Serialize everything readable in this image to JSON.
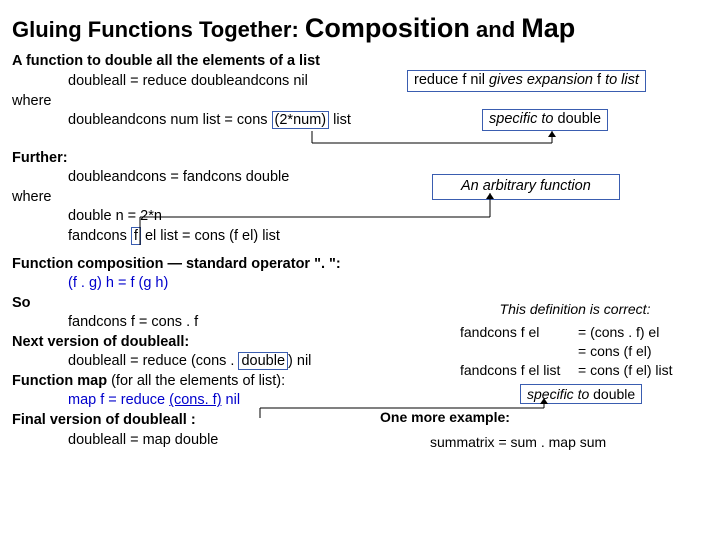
{
  "title": {
    "t1": "Gluing Functions Together:",
    "t2": "Composition",
    "t3": "and",
    "t4": "Map"
  },
  "s1": {
    "heading": "A function to double all the elements of a list",
    "line1": "doubleall = reduce doubleandcons nil",
    "note1_a": "reduce f nil ",
    "note1_b": "gives expansion",
    "note1_c": " f ",
    "note1_d": "to list",
    "where": "where",
    "line2a": "doubleandcons num list = cons ",
    "line2b": "(2*num)",
    "line2c": " list",
    "note2_a": "specific to ",
    "note2_b": "double"
  },
  "s2": {
    "heading": "Further:",
    "line1": "doubleandcons = fandcons double",
    "where": "where",
    "line2": "double n = 2*n",
    "line3a": "fandcons ",
    "line3b": "f",
    "line3c": " el list = cons (f el) list",
    "note": "An arbitrary function"
  },
  "s3": {
    "heading": "Function composition — standard operator \". \":",
    "def": "(f . g) h = f (g h)",
    "so": "So",
    "line1": "fandcons f = cons . f",
    "h2": "Next version of doubleall:",
    "line2a": "doubleall = reduce (cons . ",
    "line2b": "double",
    "line2c": ") nil",
    "h3": "Function map ",
    "h3b": "(for all the elements of list):",
    "line3a": "map f = reduce ",
    "line3b": "(cons. f)",
    "line3c": " nil",
    "h4": "Final version of doubleall :",
    "line4": "doubleall = map double"
  },
  "right": {
    "h": "This definition is correct:",
    "r1a": "fandcons f el",
    "r1b": "= (cons . f) el",
    "r2b": "= cons (f el)",
    "r3a": "fandcons f el list",
    "r3b": "= cons (f el) list",
    "box_a": "specific to ",
    "box_b": "double",
    "more": "One more example:",
    "sum": "summatrix = sum . map sum"
  }
}
